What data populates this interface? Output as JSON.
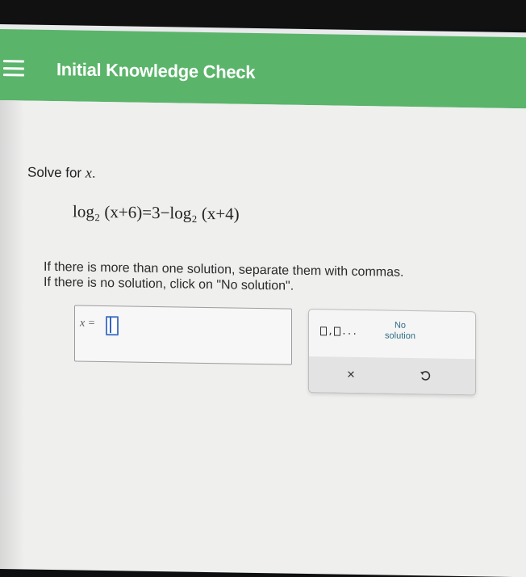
{
  "header": {
    "title": "Initial Knowledge Check",
    "menu_icon": "hamburger-menu-icon",
    "color": "#5ab46a"
  },
  "question": {
    "prompt_text": "Solve for",
    "prompt_var": "x",
    "prompt_end": ".",
    "equation": "log₂ (x+6)=3−log₂ (x+4)",
    "instruction_line1": "If there is more than one solution, separate them with commas.",
    "instruction_line2": "If there is no solution, click on \"No solution\"."
  },
  "answer": {
    "label": "x =",
    "value": ""
  },
  "keypad": {
    "list_icon": "list-separator-icon",
    "list_suffix": "...",
    "no_solution_line1": "No",
    "no_solution_line2": "solution",
    "clear_symbol": "×",
    "undo_icon": "undo-icon"
  }
}
